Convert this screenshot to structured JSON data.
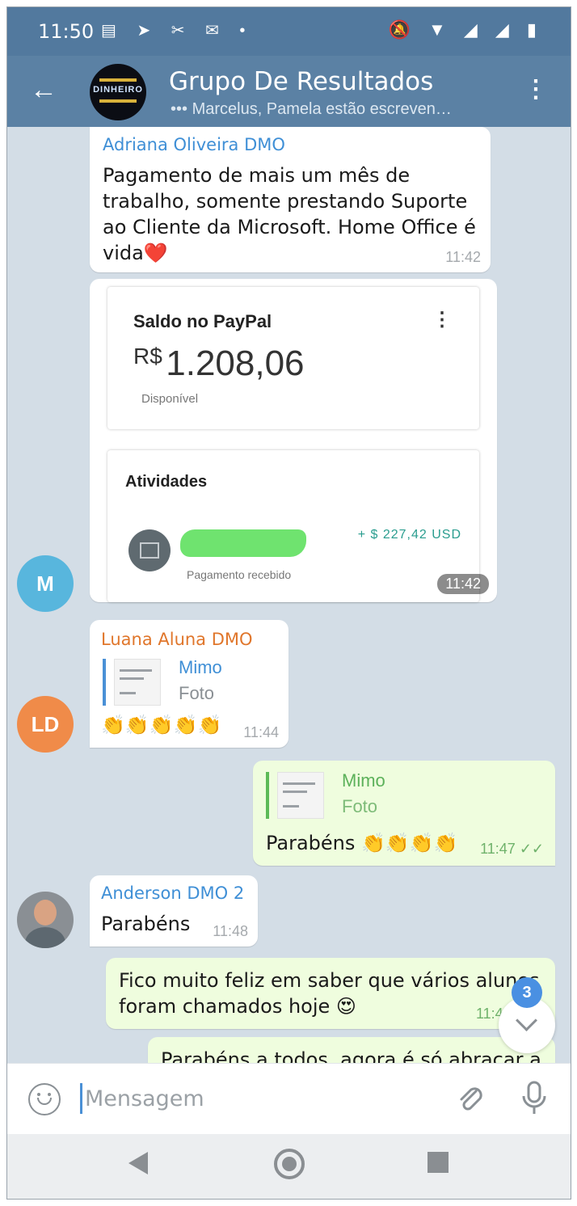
{
  "status_bar": {
    "time": "11:50",
    "left_icons": "▤ ➤ ✂ ✉ •",
    "right_icons": "🔕 ▼ ◢ ◢ ▮"
  },
  "header": {
    "title": "Grupo De Resultados",
    "subtitle": "••• Marcelus, Pamela estão escreven…",
    "avatar_text": "DINHEIRO"
  },
  "messages": {
    "adriana": {
      "sender": "Adriana Oliveira DMO",
      "line1": "Pagamento de mais um mês de",
      "line2": "trabalho, somente prestando Suporte",
      "line3": "ao Cliente da Microsoft. Home Office é",
      "line4": "vida",
      "heart": "❤️",
      "time": "11:42"
    },
    "paypal": {
      "balance_title": "Saldo no PayPal",
      "currency": "R$",
      "amount": "1.208,06",
      "available": "Disponível",
      "menu_glyph": "⋮",
      "activities_title": "Atividades",
      "activity_amount": "+ $ 227,42 USD",
      "activity_status": "Pagamento recebido",
      "time": "11:42",
      "avatar_letter": "M"
    },
    "luana": {
      "sender": "Luana Aluna DMO",
      "reply_name": "Mimo",
      "reply_type": "Foto",
      "text": "👏👏👏👏👏",
      "time": "11:44",
      "avatar_letters": "LD"
    },
    "outgoing1": {
      "reply_name": "Mimo",
      "reply_type": "Foto",
      "text": "Parabéns 👏👏👏👏",
      "time": "11:47",
      "ticks": "✓✓"
    },
    "anderson": {
      "sender": "Anderson DMO 2",
      "text": "Parabéns",
      "time": "11:48"
    },
    "outgoing2": {
      "line1": "Fico muito feliz em saber que vários alunos",
      "line2": "foram chamados hoje 😍",
      "time": "11:4"
    },
    "outgoing3": {
      "line1": "Parabéns a todos, agora é só abraçar a"
    }
  },
  "scroll": {
    "unread_count": "3"
  },
  "input": {
    "placeholder": "Mensagem"
  },
  "colors": {
    "appbar": "#5b81a4",
    "incoming_bubble": "#ffffff",
    "outgoing_bubble": "#effdde",
    "adriana_name": "#3f8fd6",
    "luana_name": "#e0762b",
    "anderson_name": "#3f8fd6",
    "avatar_m": "#58b6dd",
    "avatar_ld": "#f08b49",
    "paypal_amount_green": "#2a9d8f"
  }
}
